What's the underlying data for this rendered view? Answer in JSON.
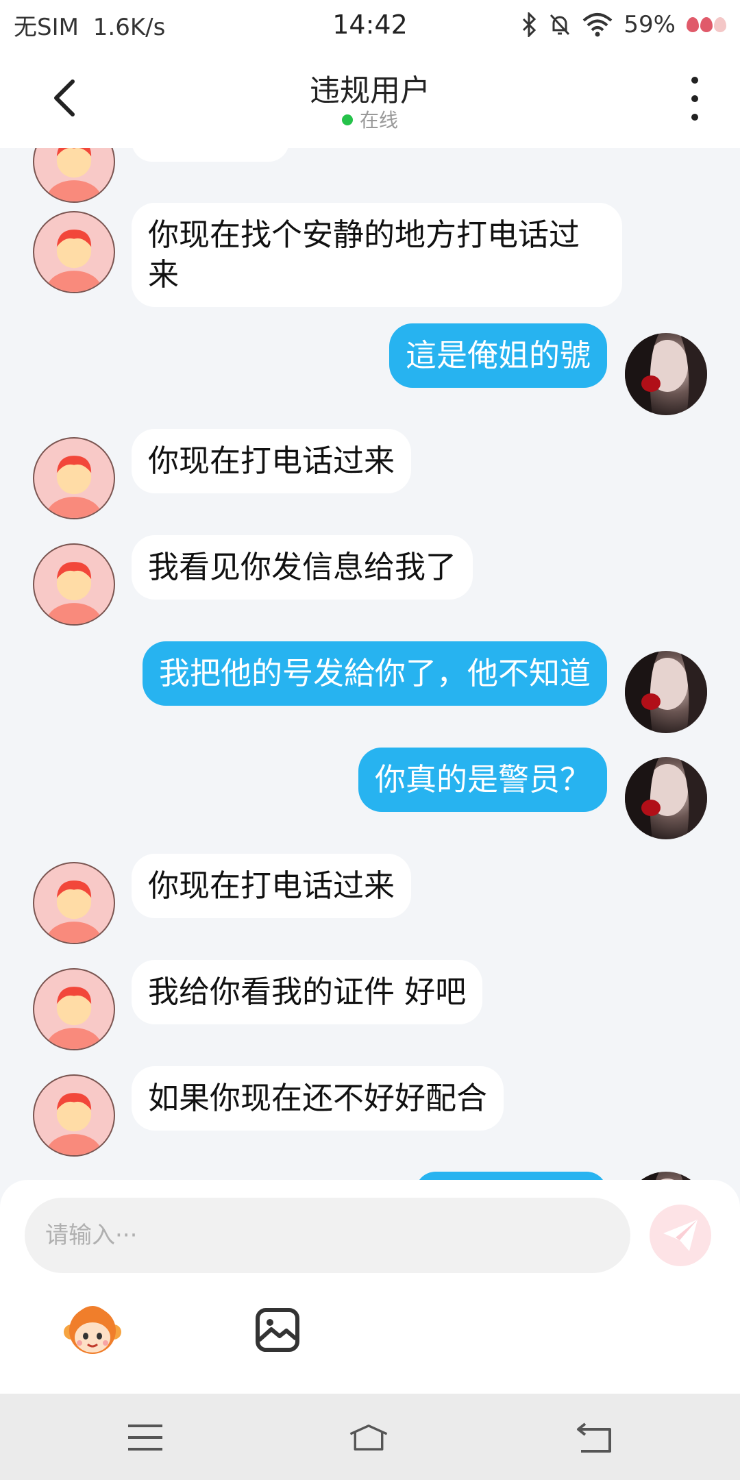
{
  "status_bar": {
    "carrier": "无SIM",
    "speed": "1.6K/s",
    "time": "14:42",
    "battery": "59%",
    "icons": [
      "bluetooth-icon",
      "silent-bell-icon",
      "wifi-icon",
      "strawberry-battery-icon"
    ]
  },
  "header": {
    "back_icon": "chevron-left-icon",
    "title": "违规用户",
    "status": "在线",
    "status_color": "#25c24a",
    "more_icon": "more-vertical-icon"
  },
  "messages": [
    {
      "side": "in",
      "text": "你现在找个安静的地方打电话过来"
    },
    {
      "side": "out",
      "text": "這是俺姐的號"
    },
    {
      "side": "in",
      "text": "你现在打电话过来"
    },
    {
      "side": "in",
      "text": "我看见你发信息给我了"
    },
    {
      "side": "out",
      "text": "我把他的号发給你了，他不知道"
    },
    {
      "side": "out",
      "text": "你真的是警员？"
    },
    {
      "side": "in",
      "text": "你现在打电话过来"
    },
    {
      "side": "in",
      "text": "我给你看我的证件 好吧"
    },
    {
      "side": "in",
      "text": "如果你现在还不好好配合"
    }
  ],
  "composer": {
    "placeholder": "请输入···",
    "send_icon": "paper-plane-icon",
    "emoji_icon": "monkey-emoji-icon",
    "image_icon": "image-icon"
  },
  "colors": {
    "outgoing_bubble": "#27b3f0",
    "incoming_bubble": "#ffffff",
    "chat_background": "#f3f5f8"
  },
  "nav_bar": {
    "menu_icon": "menu-icon",
    "home_icon": "home-icon",
    "back_icon": "back-icon"
  }
}
